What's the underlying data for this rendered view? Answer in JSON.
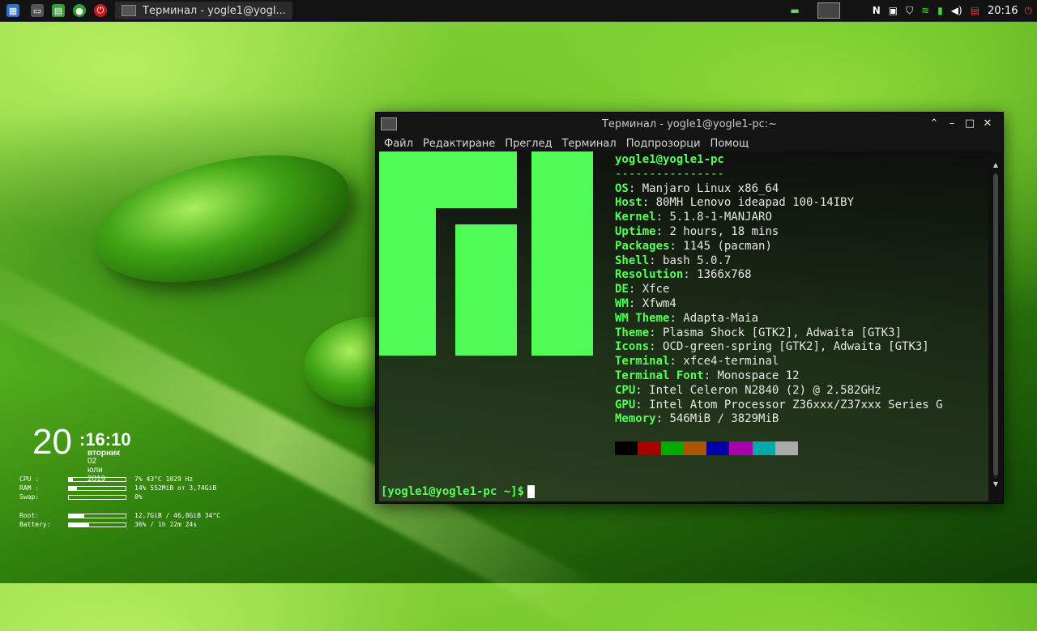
{
  "panel": {
    "task_title": "Терминал - yogle1@yogl...",
    "clock": "20:16"
  },
  "window": {
    "title": "Терминал - yogle1@yogle1-pc:~",
    "menu": [
      "Файл",
      "Редактиране",
      "Преглед",
      "Терминал",
      "Подпрозорци",
      "Помощ"
    ]
  },
  "neofetch": {
    "header": "yogle1@yogle1-pc",
    "separator": "----------------",
    "fields": [
      {
        "key": "OS",
        "value": "Manjaro Linux x86_64"
      },
      {
        "key": "Host",
        "value": "80MH Lenovo ideapad 100-14IBY"
      },
      {
        "key": "Kernel",
        "value": "5.1.8-1-MANJARO"
      },
      {
        "key": "Uptime",
        "value": "2 hours, 18 mins"
      },
      {
        "key": "Packages",
        "value": "1145 (pacman)"
      },
      {
        "key": "Shell",
        "value": "bash 5.0.7"
      },
      {
        "key": "Resolution",
        "value": "1366x768"
      },
      {
        "key": "DE",
        "value": "Xfce"
      },
      {
        "key": "WM",
        "value": "Xfwm4"
      },
      {
        "key": "WM Theme",
        "value": "Adapta-Maia"
      },
      {
        "key": "Theme",
        "value": "Plasma Shock [GTK2], Adwaita [GTK3]"
      },
      {
        "key": "Icons",
        "value": "OCD-green-spring [GTK2], Adwaita [GTK3]"
      },
      {
        "key": "Terminal",
        "value": "xfce4-terminal"
      },
      {
        "key": "Terminal Font",
        "value": "Monospace 12"
      },
      {
        "key": "CPU",
        "value": "Intel Celeron N2840 (2) @ 2.582GHz"
      },
      {
        "key": "GPU",
        "value": "Intel Atom Processor Z36xxx/Z37xxx Series G"
      },
      {
        "key": "Memory",
        "value": "546MiB / 3829MiB"
      }
    ],
    "palette": [
      "#000000",
      "#aa0000",
      "#00aa00",
      "#aa5500",
      "#0000aa",
      "#aa00aa",
      "#00aaaa",
      "#aaaaaa"
    ]
  },
  "prompt": "[yogle1@yogle1-pc ~]$",
  "conky": {
    "hour": "20",
    "time": ":16:10",
    "day": "вторник",
    "date": "02 юли 2019",
    "rows": [
      {
        "label": "CPU :",
        "percent": 7,
        "value": "7%  43°C 1029 Hz"
      },
      {
        "label": "RAM :",
        "percent": 14,
        "value": "14% 552MiB от 3,74GiB"
      },
      {
        "label": "Swap:",
        "percent": 0,
        "value": "0%"
      },
      {
        "label": "Root:",
        "percent": 27,
        "value": "12,7GiB / 46,8GiB 34°C"
      },
      {
        "label": "Battery:",
        "percent": 36,
        "value": "36% / 1h 22m 24s"
      }
    ]
  }
}
